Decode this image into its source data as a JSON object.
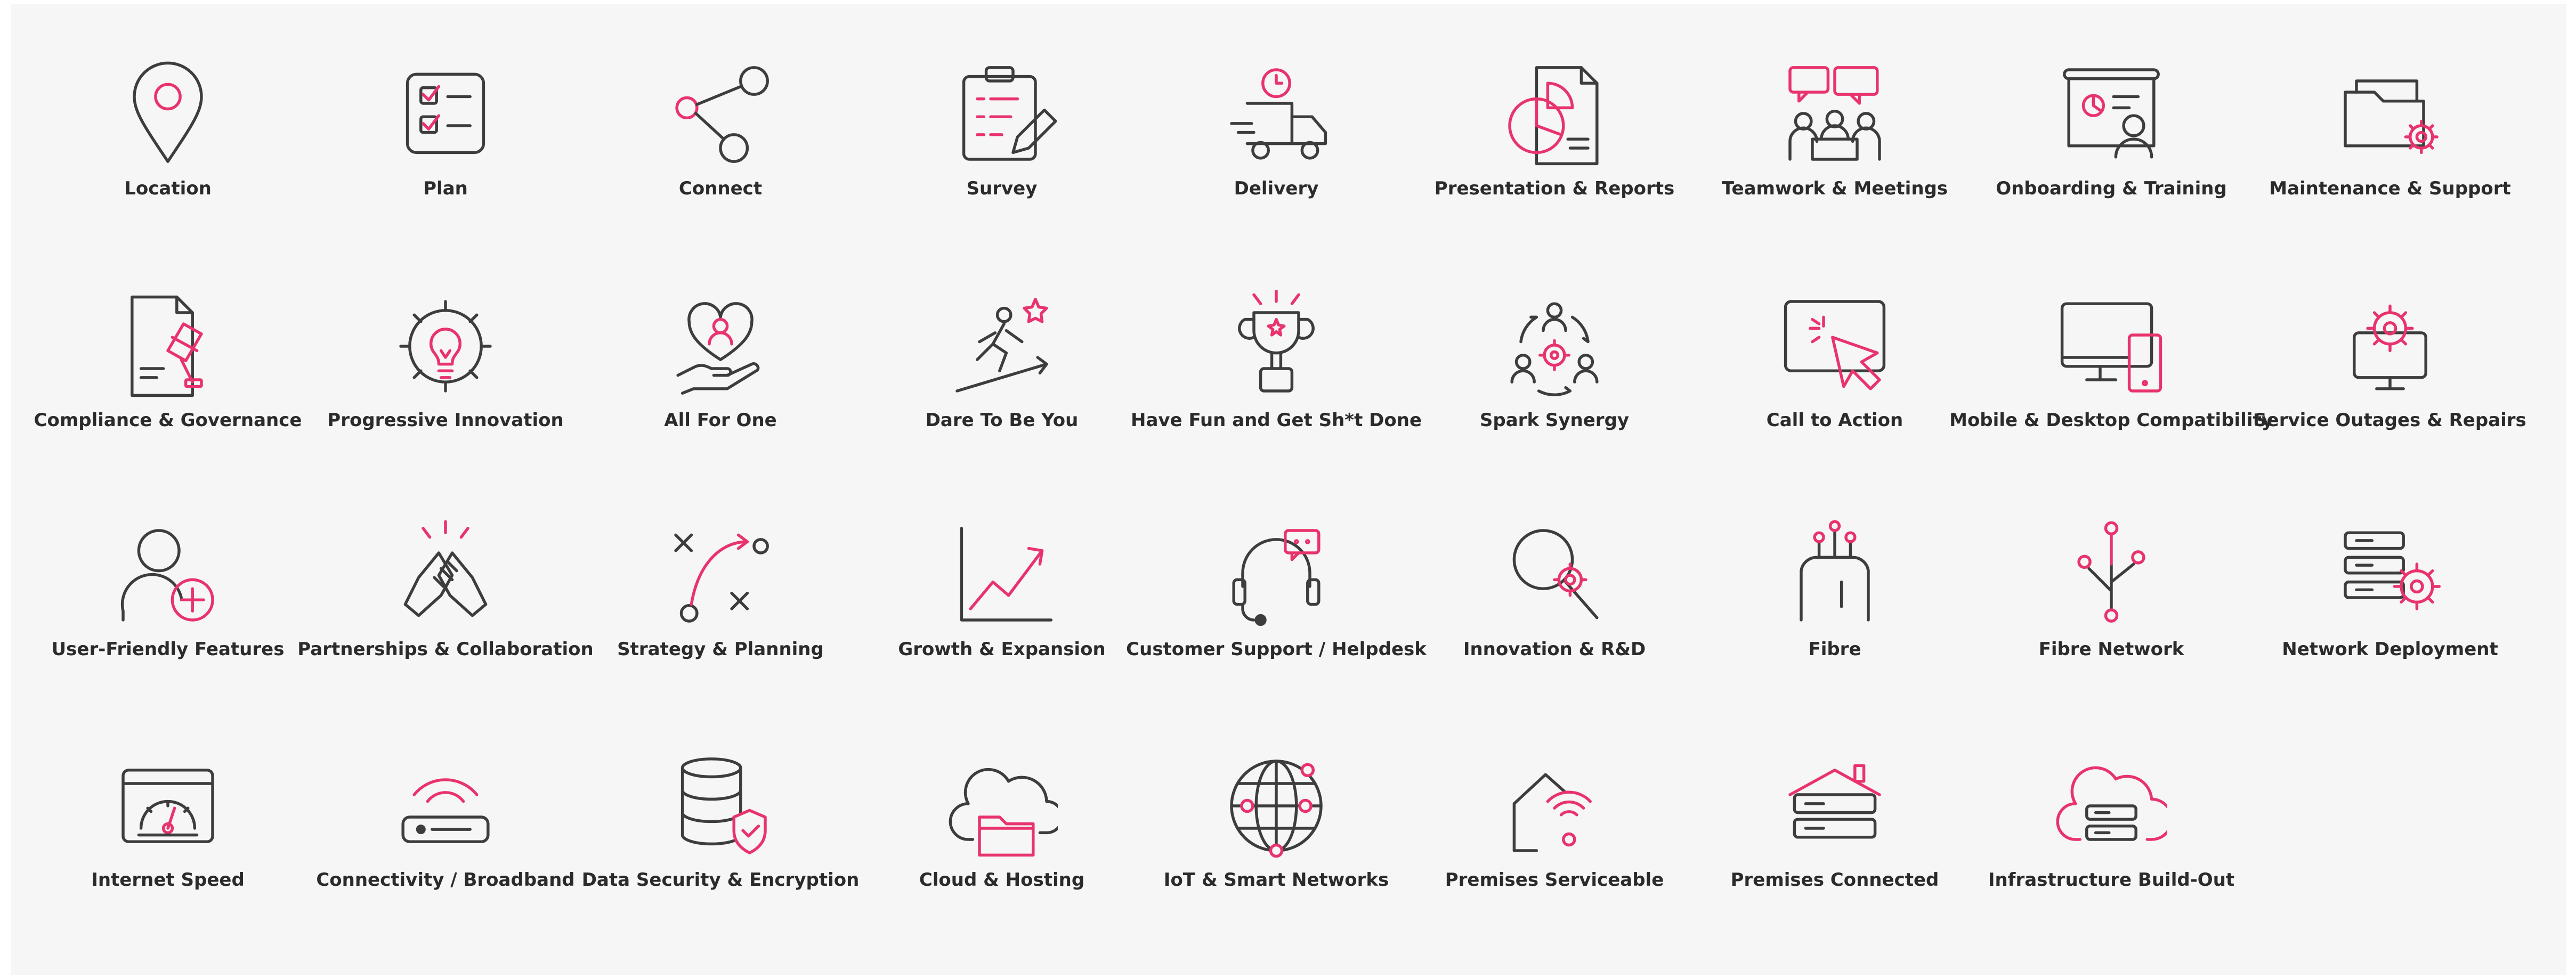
{
  "icons": [
    {
      "key": "location",
      "label": "Location"
    },
    {
      "key": "plan",
      "label": "Plan"
    },
    {
      "key": "connect",
      "label": "Connect"
    },
    {
      "key": "survey",
      "label": "Survey"
    },
    {
      "key": "delivery",
      "label": "Delivery"
    },
    {
      "key": "presentation",
      "label": "Presentation & Reports"
    },
    {
      "key": "teamwork",
      "label": "Teamwork & Meetings"
    },
    {
      "key": "onboarding",
      "label": "Onboarding & Training"
    },
    {
      "key": "maintenance",
      "label": "Maintenance & Support"
    },
    {
      "key": "compliance",
      "label": "Compliance & Governance"
    },
    {
      "key": "innovation-gear",
      "label": "Progressive Innovation"
    },
    {
      "key": "all-for-one",
      "label": "All For One"
    },
    {
      "key": "dare",
      "label": "Dare To Be You"
    },
    {
      "key": "trophy",
      "label": "Have Fun and Get Sh*t Done"
    },
    {
      "key": "synergy",
      "label": "Spark Synergy"
    },
    {
      "key": "cta",
      "label": "Call to Action"
    },
    {
      "key": "mobile-desktop",
      "label": "Mobile & Desktop Compatibility"
    },
    {
      "key": "outage",
      "label": "Service Outages & Repairs"
    },
    {
      "key": "user-plus",
      "label": "User-Friendly Features"
    },
    {
      "key": "handshake",
      "label": "Partnerships & Collaboration"
    },
    {
      "key": "strategy",
      "label": "Strategy & Planning"
    },
    {
      "key": "growth",
      "label": "Growth & Expansion"
    },
    {
      "key": "headset",
      "label": "Customer Support / Helpdesk"
    },
    {
      "key": "rnd",
      "label": "Innovation & R&D"
    },
    {
      "key": "fibre",
      "label": "Fibre"
    },
    {
      "key": "fibre-network",
      "label": "Fibre Network"
    },
    {
      "key": "network-deploy",
      "label": "Network Deployment"
    },
    {
      "key": "speed",
      "label": "Internet Speed"
    },
    {
      "key": "broadband",
      "label": "Connectivity / Broadband"
    },
    {
      "key": "data-security",
      "label": "Data Security & Encryption"
    },
    {
      "key": "cloud",
      "label": "Cloud & Hosting"
    },
    {
      "key": "iot",
      "label": "IoT & Smart Networks"
    },
    {
      "key": "premises-serviceable",
      "label": "Premises Serviceable"
    },
    {
      "key": "premises-connected",
      "label": "Premises Connected"
    },
    {
      "key": "infrastructure",
      "label": "Infrastructure Build-Out"
    }
  ],
  "colors": {
    "accent": "#e8336d",
    "line": "#3d3d3d",
    "background": "#f6f6f6"
  }
}
